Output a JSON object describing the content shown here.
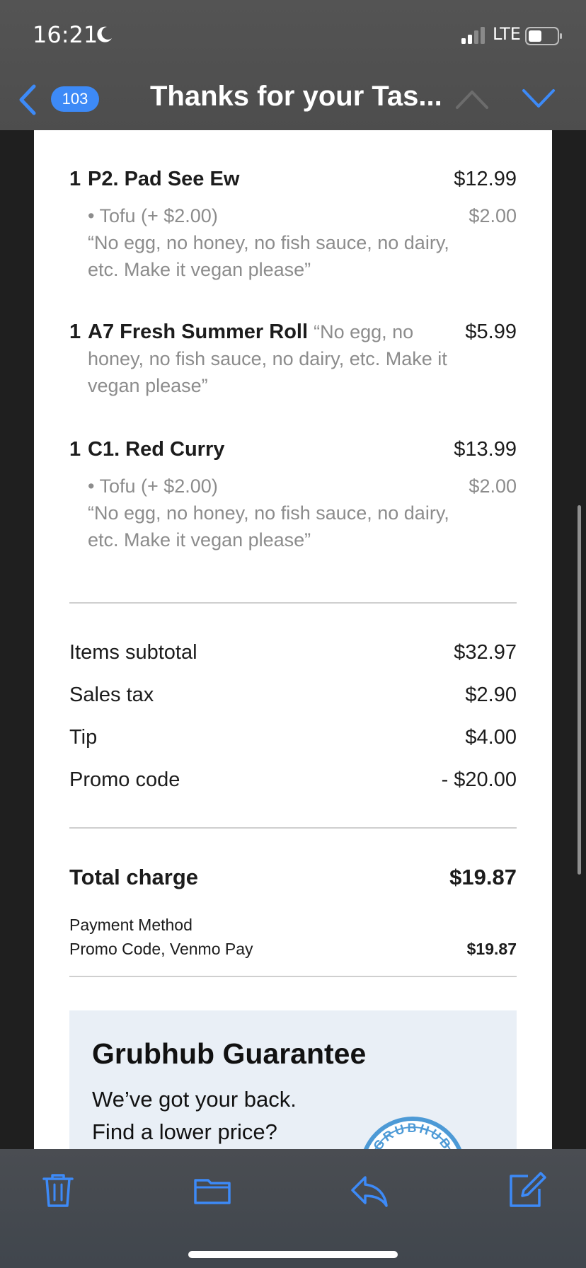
{
  "status_bar": {
    "time": "16:21",
    "network": "LTE"
  },
  "nav": {
    "unread_count": "103",
    "title": "Thanks for your Tas..."
  },
  "items": [
    {
      "qty": "1",
      "name": "P2. Pad See Ew",
      "price": "$12.99",
      "option": "• Tofu (+ $2.00)",
      "option_price": "$2.00",
      "note": "“No egg, no honey, no fish sauce, no dairy, etc. Make it vegan please”"
    },
    {
      "qty": "1",
      "name": "A7 Fresh Summer Roll",
      "price": "$5.99",
      "inline_note": "“No egg, no",
      "note": "honey, no fish sauce, no dairy, etc. Make it vegan please”"
    },
    {
      "qty": "1",
      "name": "C1. Red Curry",
      "price": "$13.99",
      "option": "• Tofu (+ $2.00)",
      "option_price": "$2.00",
      "note": "“No egg, no honey, no fish sauce, no dairy, etc. Make it vegan please”"
    }
  ],
  "summary": [
    {
      "label": "Items subtotal",
      "value": "$32.97"
    },
    {
      "label": "Sales tax",
      "value": "$2.90"
    },
    {
      "label": "Tip",
      "value": "$4.00"
    },
    {
      "label": "Promo code",
      "value": "- $20.00"
    }
  ],
  "total": {
    "label": "Total charge",
    "value": "$19.87"
  },
  "payment": {
    "heading": "Payment Method",
    "method": "Promo Code, Venmo Pay",
    "amount": "$19.87"
  },
  "guarantee": {
    "title": "Grubhub Guarantee",
    "line1": "We’ve got your back.",
    "line2": "Find a lower price?",
    "seal_text": "GRUBHUB"
  },
  "colors": {
    "accent": "#3d8af7",
    "muted_text": "#8c8c8c",
    "guarantee_bg": "#e9eff6"
  },
  "toolbar": {
    "icons": [
      "trash-icon",
      "folder-icon",
      "reply-icon",
      "compose-icon"
    ]
  }
}
